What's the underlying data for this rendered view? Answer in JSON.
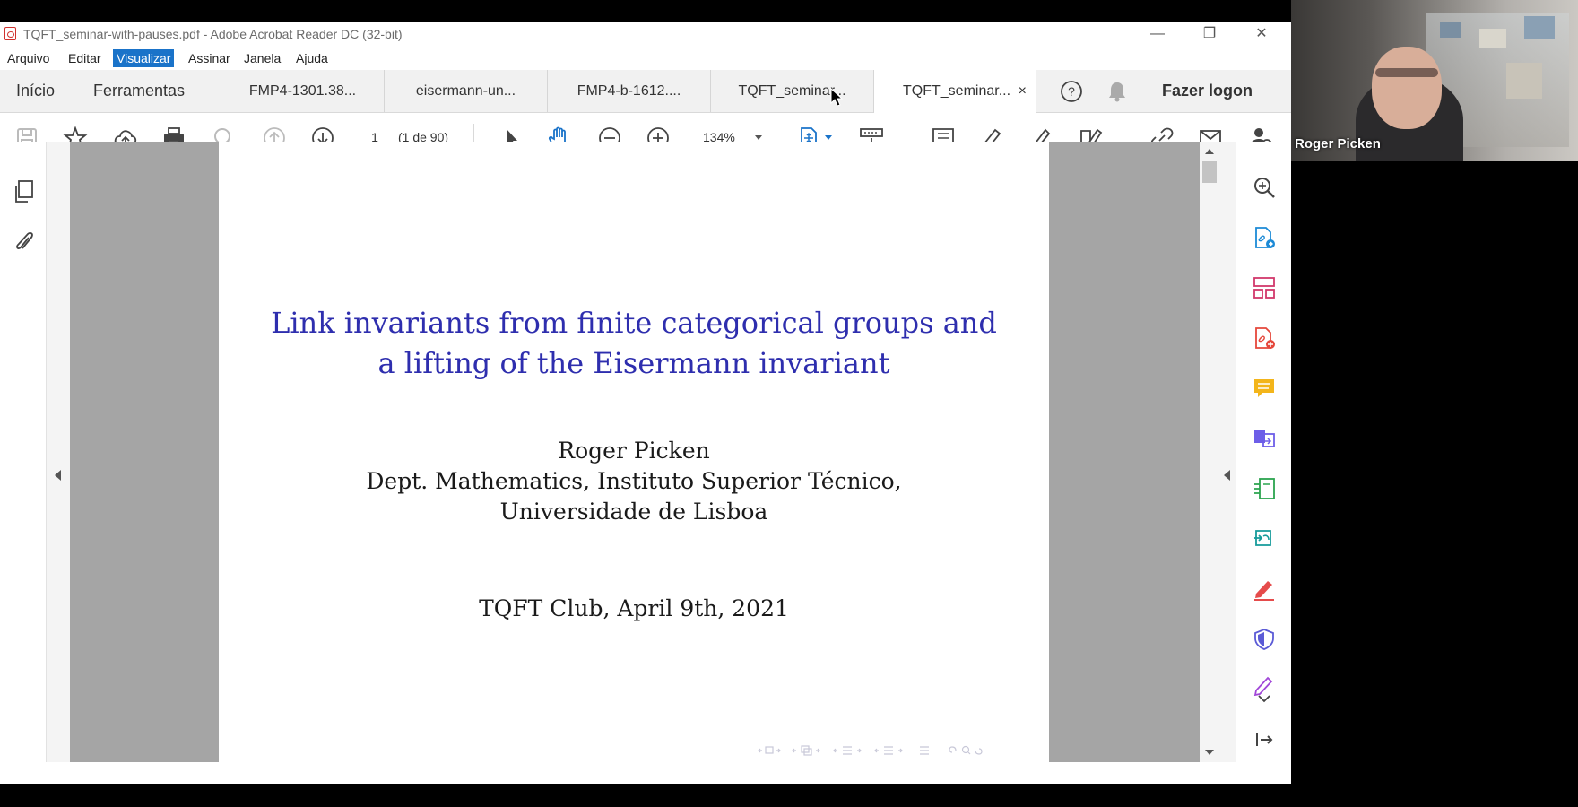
{
  "window": {
    "title": "TQFT_seminar-with-pauses.pdf - Adobe Acrobat Reader DC (32-bit)",
    "controls": {
      "minimize": "—",
      "restore": "❐",
      "close": "✕"
    }
  },
  "menu": [
    "Arquivo",
    "Editar",
    "Visualizar",
    "Assinar",
    "Janela",
    "Ajuda"
  ],
  "menu_active": "Visualizar",
  "nav": {
    "home": "Início",
    "tools": "Ferramentas"
  },
  "tabs": [
    {
      "label": "FMP4-1301.38...",
      "active": false
    },
    {
      "label": "eisermann-un...",
      "active": false
    },
    {
      "label": "FMP4-b-1612....",
      "active": false
    },
    {
      "label": "TQFT_seminar...",
      "active": false
    },
    {
      "label": "TQFT_seminar...",
      "active": true
    }
  ],
  "tab_close": "×",
  "header_right": {
    "login": "Fazer logon"
  },
  "toolbar": {
    "page_number": "1",
    "page_total": "(1 de 90)",
    "zoom": "134%"
  },
  "slide": {
    "title_line1": "Link invariants from finite categorical groups and",
    "title_line2": "a lifting of the Eisermann invariant",
    "author": "Roger Picken",
    "affiliation_line1": "Dept. Mathematics, Instituto Superior Técnico,",
    "affiliation_line2": "Universidade de Lisboa",
    "event": "TQFT Club, April 9th, 2021"
  },
  "video": {
    "participant_name": "Roger Picken"
  },
  "colors": {
    "accent": "#1a73c9",
    "slide_title": "#2e2eae",
    "gray_bg": "#a5a5a5"
  }
}
